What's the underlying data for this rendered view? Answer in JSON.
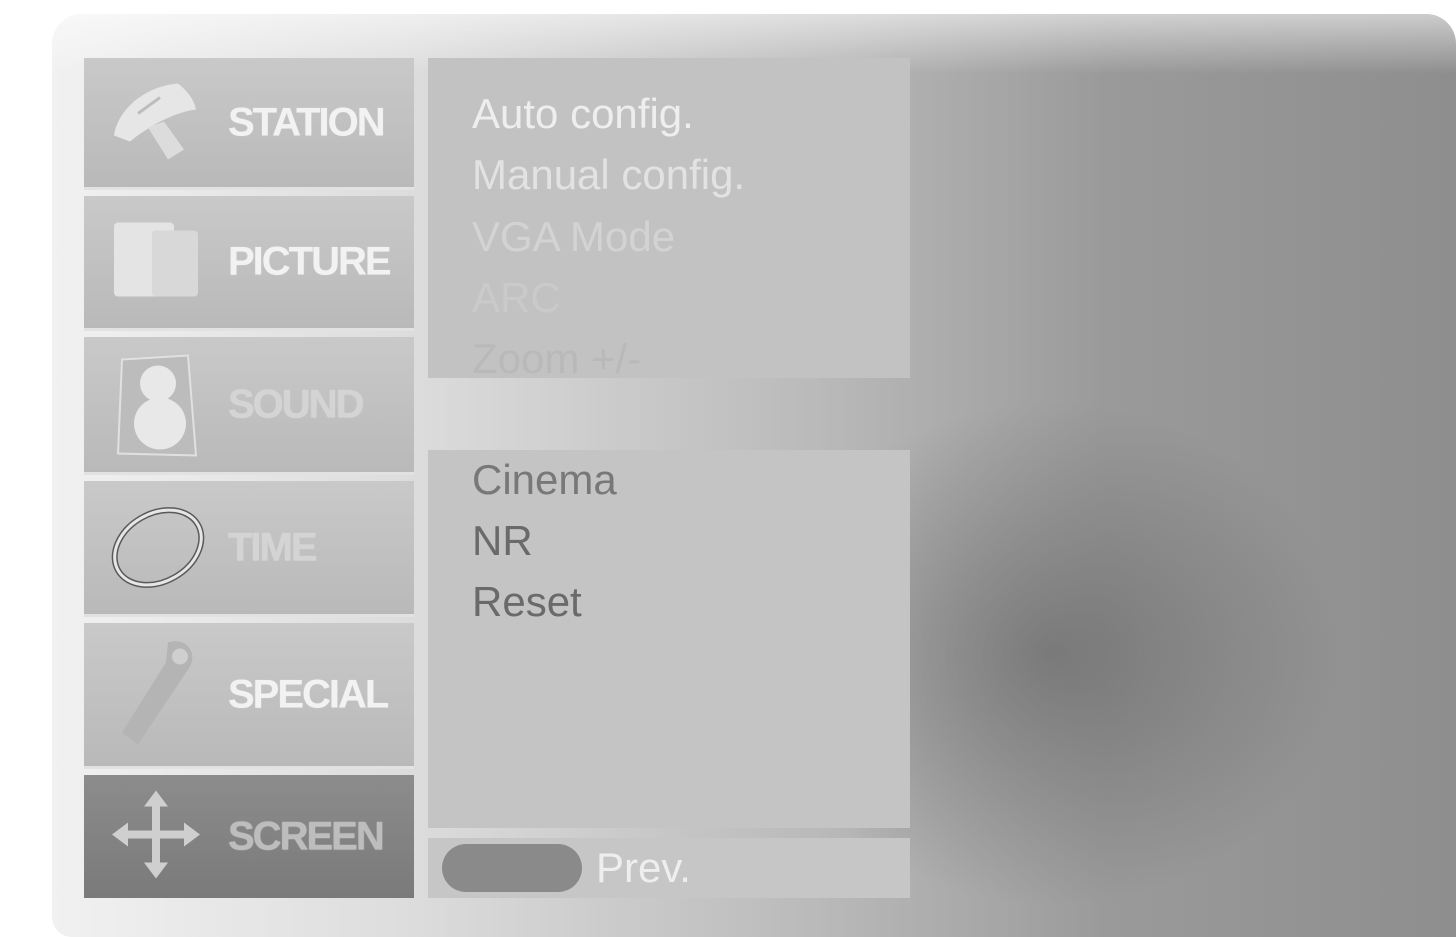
{
  "menu": {
    "items": [
      {
        "label": "STATION",
        "icon": "satellite-dish-icon",
        "state": "bright"
      },
      {
        "label": "PICTURE",
        "icon": "picture-folder-icon",
        "state": "bright"
      },
      {
        "label": "SOUND",
        "icon": "speaker-icon",
        "state": "dim"
      },
      {
        "label": "TIME",
        "icon": "clock-ring-icon",
        "state": "dim"
      },
      {
        "label": "SPECIAL",
        "icon": "key-tag-icon",
        "state": "bright"
      },
      {
        "label": "SCREEN",
        "icon": "move-arrows-icon",
        "state": "selected"
      }
    ]
  },
  "submenu": {
    "top_items": [
      "Auto config.",
      "Manual config.",
      "VGA Mode",
      "ARC",
      "Zoom +/-"
    ],
    "bottom_items": [
      "Cinema",
      "NR",
      "Reset"
    ]
  },
  "footer": {
    "prev_label": "Prev."
  },
  "colors": {
    "panel_highlight": "#f1f1f1",
    "panel_shadow": "#8e8e8e",
    "selected_item": "#7a7a7a",
    "menu_text": "#f2f2f2"
  }
}
